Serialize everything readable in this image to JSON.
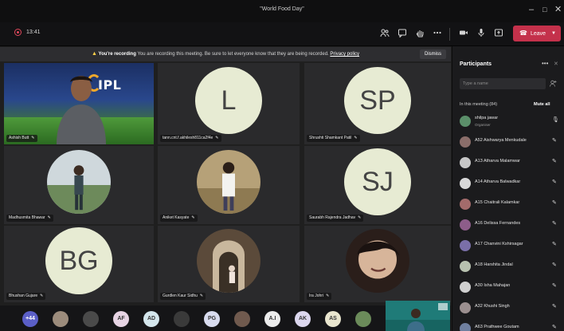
{
  "window": {
    "title": "\"World Food Day\"",
    "controls": [
      "–",
      "□",
      "✕"
    ]
  },
  "toolbar": {
    "timer": "13:41",
    "leave_label": "Leave",
    "icons": [
      "participants-icon",
      "chat-icon",
      "raise-hand-icon",
      "more-icon",
      "camera-icon",
      "mic-icon",
      "share-icon"
    ]
  },
  "banner": {
    "bold": "You're recording",
    "text": "You are recording this meeting. Be sure to let everyone know that they are being recorded.",
    "link": "Privacy policy",
    "dismiss": "Dismiss"
  },
  "tiles": [
    {
      "label": "Ashish Butt",
      "kind": "ipl",
      "logo_text": "IPL"
    },
    {
      "label": "tann.cnt.f.akhilesh811ca2f4e",
      "kind": "initials",
      "initials": "L"
    },
    {
      "label": "Shrushti Shamkant Patil",
      "kind": "initials",
      "initials": "SP"
    },
    {
      "label": "Madhusmita Bhawar",
      "kind": "photo"
    },
    {
      "label": "Aniket Kasyate",
      "kind": "photo"
    },
    {
      "label": "Saurabh Rajendra Jadhav",
      "kind": "initials",
      "initials": "SJ"
    },
    {
      "label": "Bhushan Gujare",
      "kind": "initials",
      "initials": "BG"
    },
    {
      "label": "Gurdlen Kaur Sidhu",
      "kind": "photo"
    },
    {
      "label": "Ira Johri",
      "kind": "photo"
    }
  ],
  "panel": {
    "title": "Participants",
    "search_placeholder": "Type a name",
    "in_meeting": "In this meeting (84)",
    "mute_all": "Mute all",
    "people": [
      {
        "name": "shilpa jawar",
        "sub": "Organiser",
        "color": "#5b8f6a"
      },
      {
        "name": "A52 Aishwarya Menkudale",
        "sub": "",
        "color": "#8b6e6a"
      },
      {
        "name": "A13 Atharva Malamwar",
        "sub": "",
        "color": "#c7c7c7"
      },
      {
        "name": "A14 Atharva Balwadkar",
        "sub": "",
        "color": "#d8d8d8"
      },
      {
        "name": "A15 Chaitrali Kalamkar",
        "sub": "",
        "color": "#a36b6b"
      },
      {
        "name": "A16 Delissa Fernandes",
        "sub": "",
        "color": "#8d5d8a"
      },
      {
        "name": "A17 Chanvini Kshirsagar",
        "sub": "",
        "color": "#7a6fa8"
      },
      {
        "name": "A18 Harshita Jindal",
        "sub": "",
        "color": "#b8c2b0"
      },
      {
        "name": "A30 Isha Mahajan",
        "sub": "",
        "color": "#d0d0d0"
      },
      {
        "name": "A32 Khushi Singh",
        "sub": "",
        "color": "#9b8f8f"
      },
      {
        "name": "A63 Prathwee Goutam",
        "sub": "",
        "color": "#6f7f9f"
      }
    ]
  },
  "strip": [
    {
      "kind": "count",
      "text": "+44",
      "color": "#5b5fc7"
    },
    {
      "kind": "photo",
      "text": "",
      "color": "#9c8c7c"
    },
    {
      "kind": "photo",
      "text": "",
      "color": "#4a4a4a"
    },
    {
      "kind": "initials",
      "text": "AF",
      "color": "#e7d4e4"
    },
    {
      "kind": "initials",
      "text": "AD",
      "color": "#d4e6ec"
    },
    {
      "kind": "photo",
      "text": "",
      "color": "#3a3a3a"
    },
    {
      "kind": "initials",
      "text": "PG",
      "color": "#d9dcef"
    },
    {
      "kind": "photo",
      "text": "",
      "color": "#705a4e"
    },
    {
      "kind": "initials",
      "text": "A.I",
      "color": "#ececec"
    },
    {
      "kind": "initials",
      "text": "AK",
      "color": "#dcd7ee"
    },
    {
      "kind": "initials",
      "text": "AS",
      "color": "#e9e6cf"
    },
    {
      "kind": "photo",
      "text": "",
      "color": "#6b8b5a"
    }
  ]
}
